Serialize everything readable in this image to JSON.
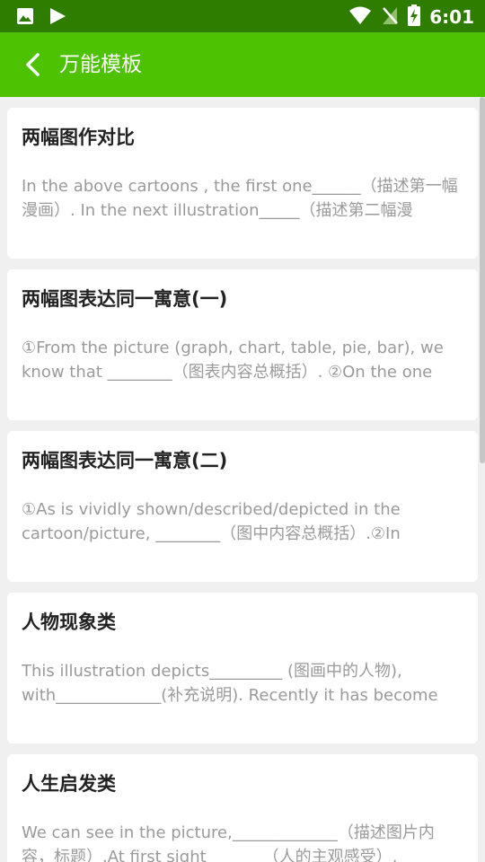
{
  "status_bar": {
    "time": "6:01",
    "icons": [
      "image-icon",
      "play-store-icon",
      "wifi-icon",
      "no-sim-icon",
      "battery-charging-icon"
    ]
  },
  "app_bar": {
    "title": "万能模板",
    "background": "#4cc200",
    "status_background": "#2f7d00"
  },
  "cards": [
    {
      "title": "两幅图作对比",
      "text": "In the above cartoons , the first one______（描述第一幅漫画）. In the next illustration_____（描述第二幅漫"
    },
    {
      "title": "两幅图表达同一寓意(一)",
      "text": "①From the picture (graph, chart, table, pie, bar), we know that ________（图表内容总概括）. ②On the one"
    },
    {
      "title": "两幅图表达同一寓意(二)",
      "text": "①As is vividly shown/described/depicted in the cartoon/picture, ________（图中内容总概括）.②In"
    },
    {
      "title": "人物现象类",
      "text": "This illustration depicts_________ (图画中的人物), with_____________(补充说明). Recently it has become"
    },
    {
      "title": "人生启发类",
      "text": "We can see in the picture,_____________（描述图片内容，标题）.At first sight_______（人的主观感受）,"
    }
  ]
}
